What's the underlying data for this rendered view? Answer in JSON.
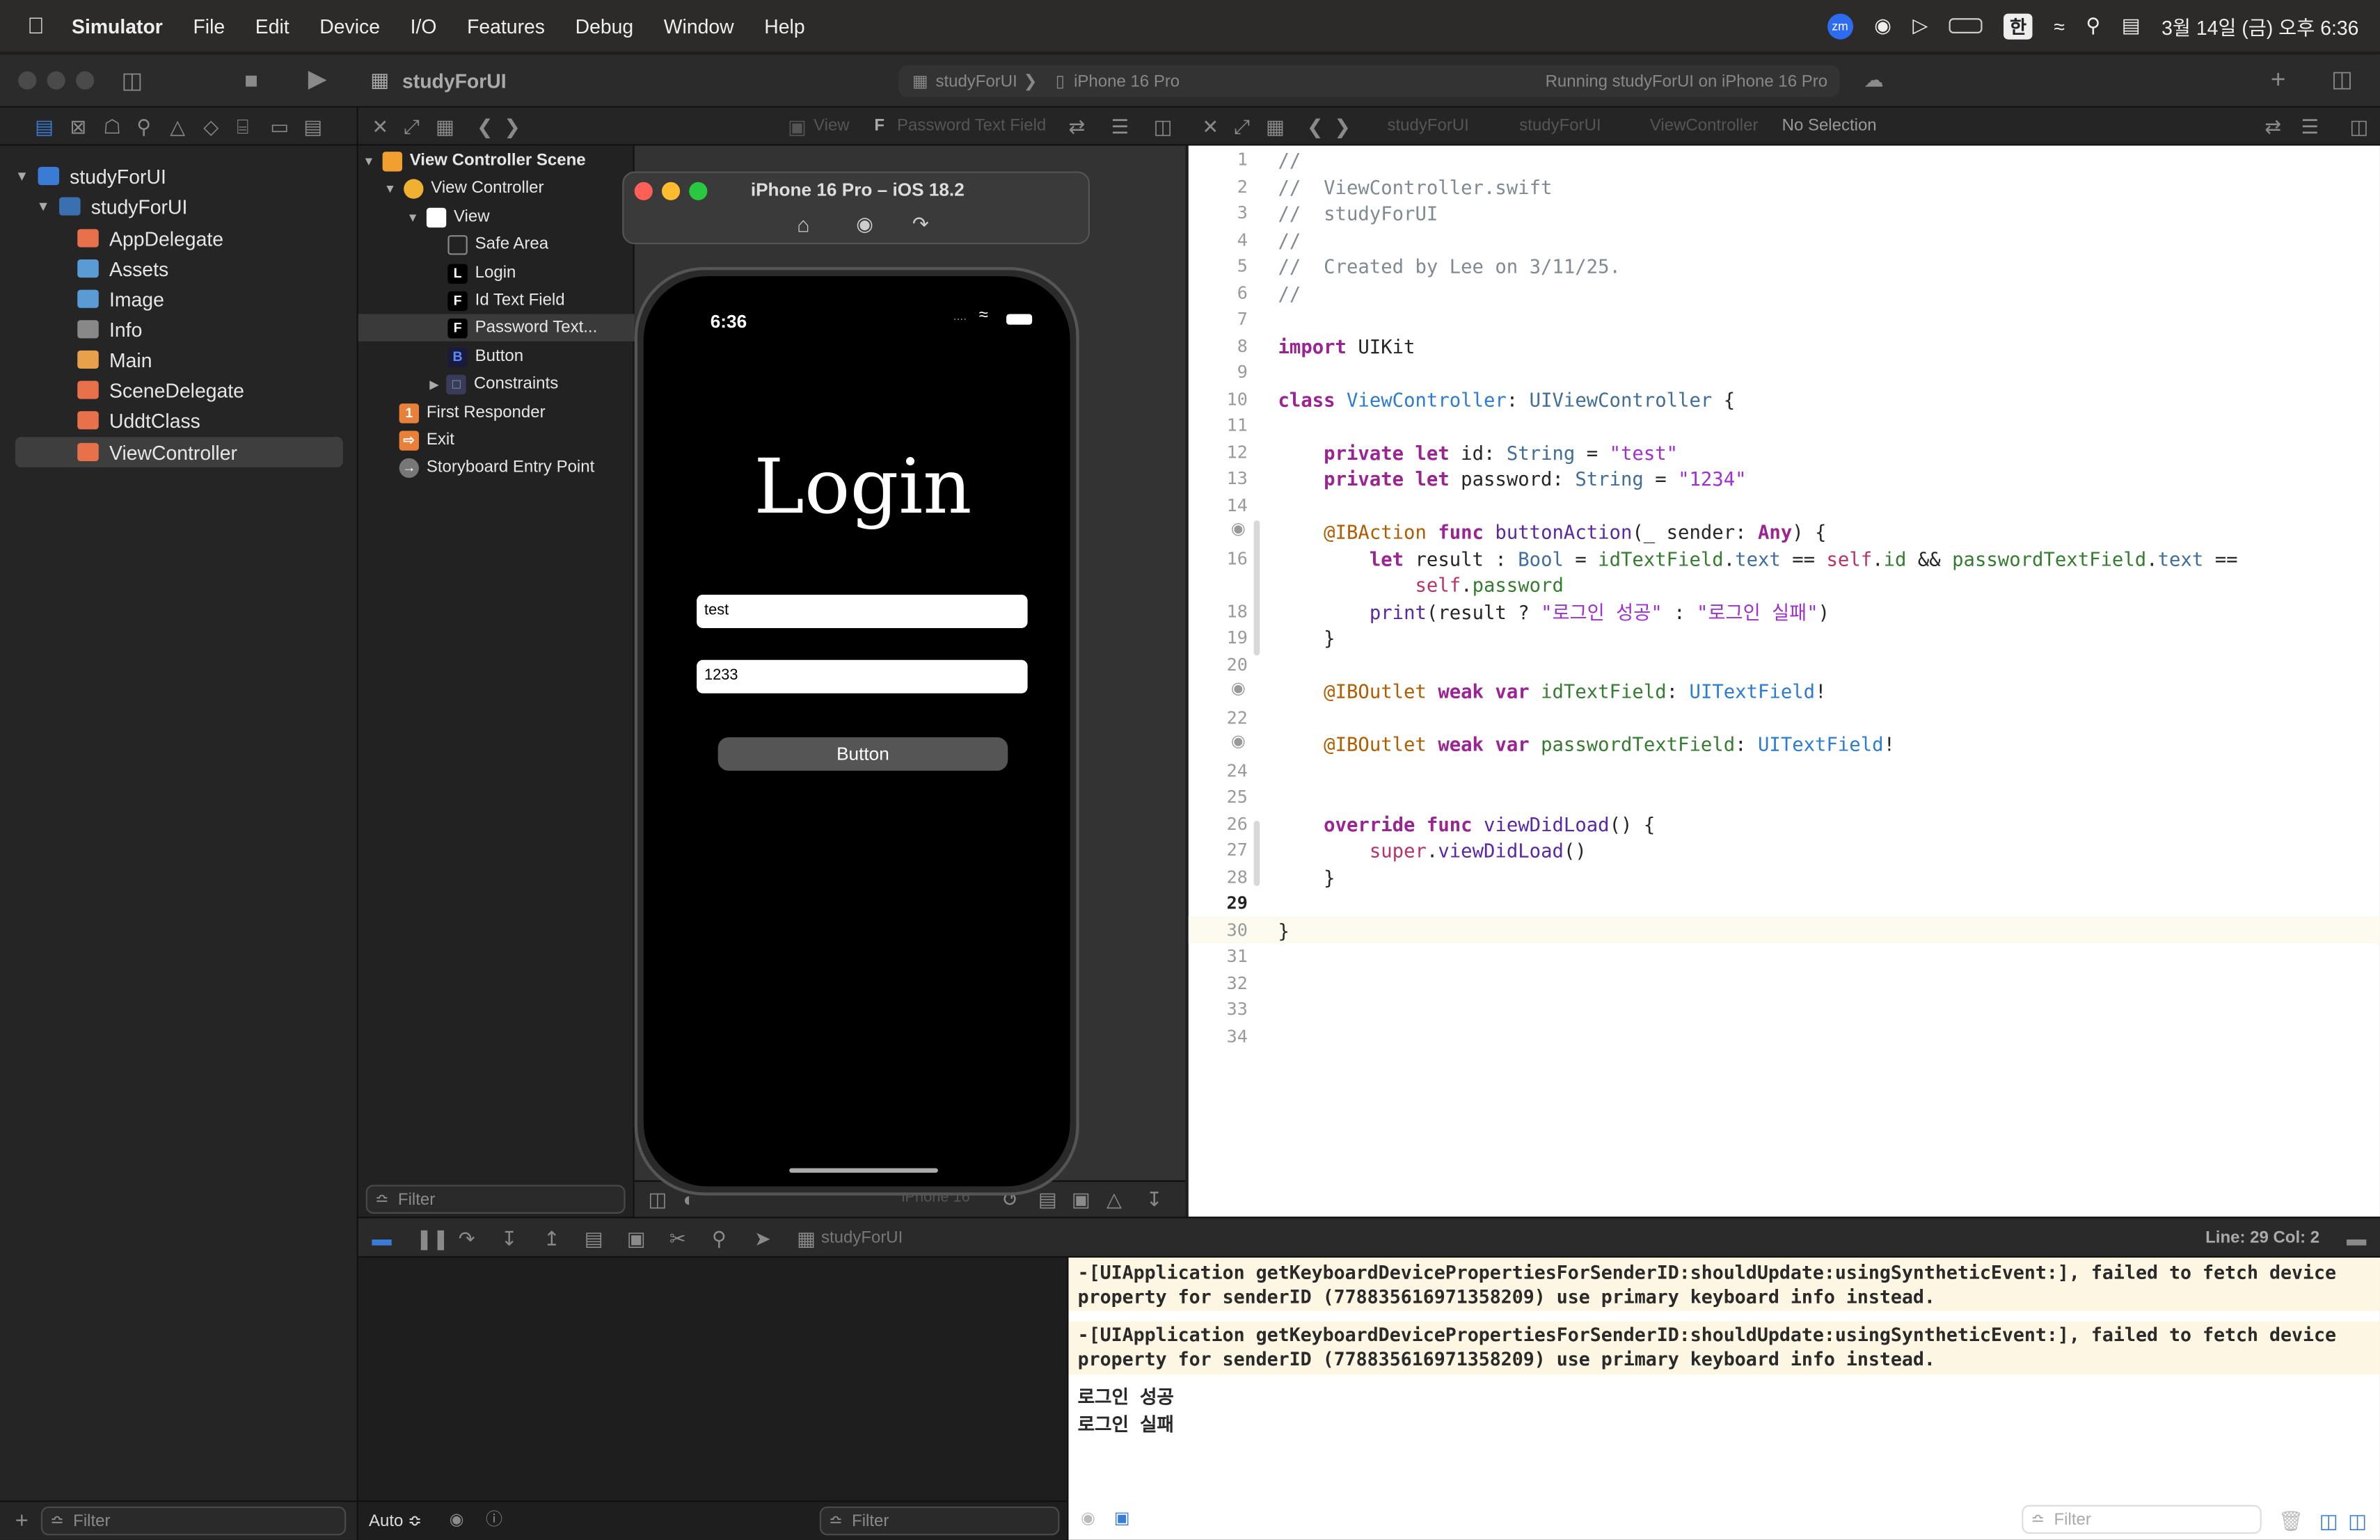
{
  "menubar": {
    "app": "Simulator",
    "items": [
      "File",
      "Edit",
      "Device",
      "I/O",
      "Features",
      "Debug",
      "Window",
      "Help"
    ],
    "input_source": "한",
    "clock": "3월 14일 (금) 오후 6:36"
  },
  "toolbar": {
    "project": "studyForUI",
    "scheme": "studyForUI",
    "device": "iPhone 16 Pro",
    "status": "Running studyForUI on iPhone 16 Pro"
  },
  "navigator": {
    "items": [
      {
        "label": "studyForUI",
        "color": "#3a7bd5"
      },
      {
        "label": "studyForUI",
        "color": "#3a6fb0"
      },
      {
        "label": "AppDelegate",
        "color": "#e8704a"
      },
      {
        "label": "Assets",
        "color": "#5a9bd5"
      },
      {
        "label": "Image",
        "color": "#5a9bd5"
      },
      {
        "label": "Info",
        "color": "#888888"
      },
      {
        "label": "Main",
        "color": "#e8a04a"
      },
      {
        "label": "SceneDelegate",
        "color": "#e8704a"
      },
      {
        "label": "UddtClass",
        "color": "#e8704a"
      },
      {
        "label": "ViewController",
        "color": "#e8704a"
      }
    ],
    "filter_placeholder": "Filter"
  },
  "outline": {
    "items": [
      {
        "label": "View Controller Scene",
        "badge": "",
        "color": "#f0a030"
      },
      {
        "label": "View Controller",
        "badge": "",
        "color": "#f0b030"
      },
      {
        "label": "View",
        "badge": "",
        "color": "#ffffff"
      },
      {
        "label": "Safe Area",
        "badge": "",
        "color": "#444444"
      },
      {
        "label": "Login",
        "badge": "L",
        "color": "#000000"
      },
      {
        "label": "Id Text Field",
        "badge": "F",
        "color": "#000000"
      },
      {
        "label": "Password Text...",
        "badge": "F",
        "color": "#000000"
      },
      {
        "label": "Button",
        "badge": "B",
        "color": "#1a1a3a"
      },
      {
        "label": "Constraints",
        "badge": "",
        "color": "#3a3a5a"
      },
      {
        "label": "First Responder",
        "badge": "1",
        "color": "#e8803a"
      },
      {
        "label": "Exit",
        "badge": "",
        "color": "#e8803a"
      },
      {
        "label": "Storyboard Entry Point",
        "badge": "",
        "color": "#777777"
      }
    ],
    "filter_placeholder": "Filter"
  },
  "jumpbar_left": {
    "scene": "View",
    "item": "Password Text Field"
  },
  "jumpbar_right": {
    "a": "studyForUI",
    "b": "studyForUI",
    "c": "ViewController",
    "d": "No Selection"
  },
  "simulator": {
    "title": "iPhone 16 Pro – iOS 18.2",
    "time": "6:36",
    "heading": "Login",
    "id_value": "test",
    "password_value": "1233",
    "button_label": "Button",
    "device_bar_label": "iPhone 16"
  },
  "editor": {
    "cursor_line": 29,
    "status": "Line: 29  Col: 2"
  },
  "console": {
    "lines": [
      "-[UIApplication getKeyboardDevicePropertiesForSenderID:shouldUpdate:usingSyntheticEvent:], failed to fetch device",
      "property for senderID (778835616971358209) use primary keyboard info instead.",
      "-[UIApplication getKeyboardDevicePropertiesForSenderID:shouldUpdate:usingSyntheticEvent:], failed to fetch device",
      "property for senderID (778835616971358209) use primary keyboard info instead.",
      "로그인 성공",
      "로그인 실패"
    ],
    "auto_label": "Auto ≎",
    "filter_placeholder": "Filter",
    "target": "studyForUI"
  }
}
